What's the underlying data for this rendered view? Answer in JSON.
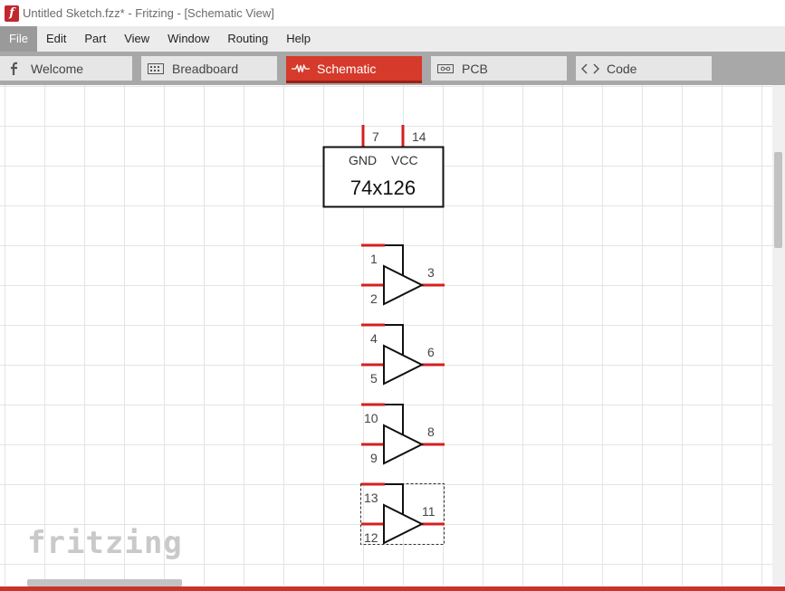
{
  "window": {
    "title": "Untitled Sketch.fzz* - Fritzing - [Schematic View]",
    "app_icon": "fritzing-f-icon"
  },
  "menu": [
    "File",
    "Edit",
    "Part",
    "View",
    "Window",
    "Routing",
    "Help"
  ],
  "tabs": [
    {
      "label": "Welcome",
      "icon": "fritzing-f-icon"
    },
    {
      "label": "Breadboard",
      "icon": "breadboard-icon"
    },
    {
      "label": "Schematic",
      "icon": "resistor-icon"
    },
    {
      "label": "PCB",
      "icon": "pcb-icon"
    },
    {
      "label": "Code",
      "icon": "code-brackets-icon"
    }
  ],
  "chip": {
    "name": "74x126",
    "power_pins": [
      {
        "number": "7",
        "label": "GND"
      },
      {
        "number": "14",
        "label": "VCC"
      }
    ],
    "buffers": [
      {
        "enable": "1",
        "input": "2",
        "output": "3"
      },
      {
        "enable": "4",
        "input": "5",
        "output": "6"
      },
      {
        "enable": "10",
        "input": "9",
        "output": "8"
      },
      {
        "enable": "13",
        "input": "12",
        "output": "11",
        "selected": true
      }
    ]
  },
  "watermark": "fritzing",
  "colors": {
    "accent": "#d63a2a",
    "pin": "#d42020",
    "pin_glow": "#f2a8a8"
  }
}
